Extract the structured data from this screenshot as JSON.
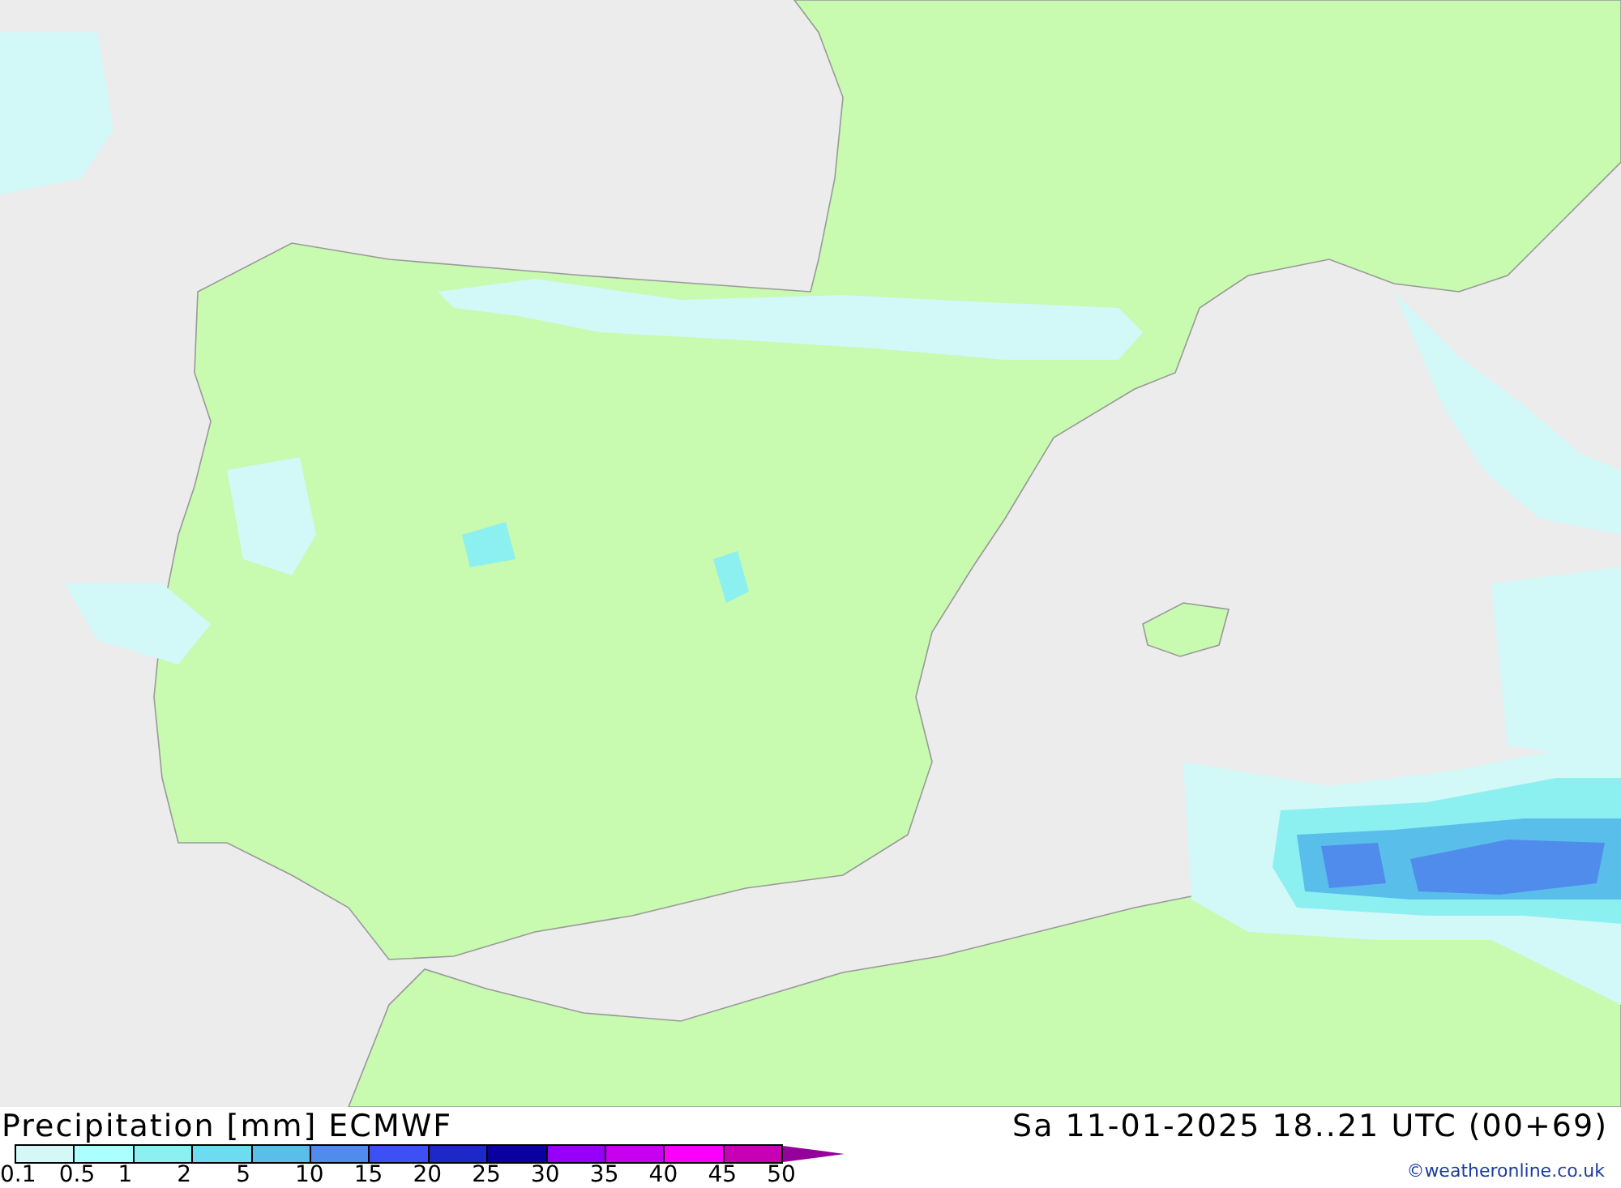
{
  "title": "Precipitation [mm] ECMWF",
  "valid_time": "Sa 11-01-2025 18..21 UTC (00+69)",
  "legend": {
    "bins": [
      {
        "color": "#d4f8f8"
      },
      {
        "color": "#aaffff"
      },
      {
        "color": "#8cf0f0"
      },
      {
        "color": "#6edcf0"
      },
      {
        "color": "#5abeeb"
      },
      {
        "color": "#508ceb"
      },
      {
        "color": "#3c50f5"
      },
      {
        "color": "#1e28c8"
      },
      {
        "color": "#0a00a0"
      },
      {
        "color": "#9600fa"
      },
      {
        "color": "#c800f0"
      },
      {
        "color": "#fa00fa"
      },
      {
        "color": "#c800b4"
      }
    ],
    "labels": [
      "0.1",
      "0.5",
      "1",
      "2",
      "5",
      "10",
      "15",
      "20",
      "25",
      "30",
      "35",
      "40",
      "45",
      "50"
    ]
  },
  "credit": "©weatheronline.co.uk"
}
